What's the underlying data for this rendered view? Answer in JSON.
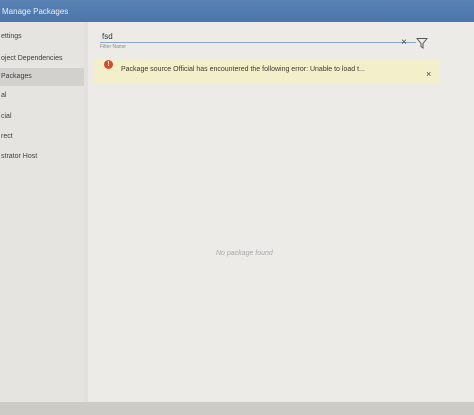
{
  "window": {
    "title": "Manage Packages"
  },
  "sidebar": {
    "items": [
      {
        "label": "ettings"
      },
      {
        "label": "oject Dependencies"
      },
      {
        "label": "Packages",
        "selected": true
      },
      {
        "label": "al"
      },
      {
        "label": "cial"
      },
      {
        "label": "rect"
      },
      {
        "label": "strator Host"
      }
    ]
  },
  "search": {
    "value": "fsd",
    "hint": "Filter Name"
  },
  "error": {
    "icon": "!",
    "message": "Package source Official has encountered the following error: Unable to load t..."
  },
  "icons": {
    "clear": "×",
    "close": "×"
  },
  "results": {
    "empty_message": "No package found"
  },
  "colors": {
    "titlebar": "#4a76ad",
    "error_background": "#f4efcb",
    "error_icon": "#d64a2e"
  }
}
